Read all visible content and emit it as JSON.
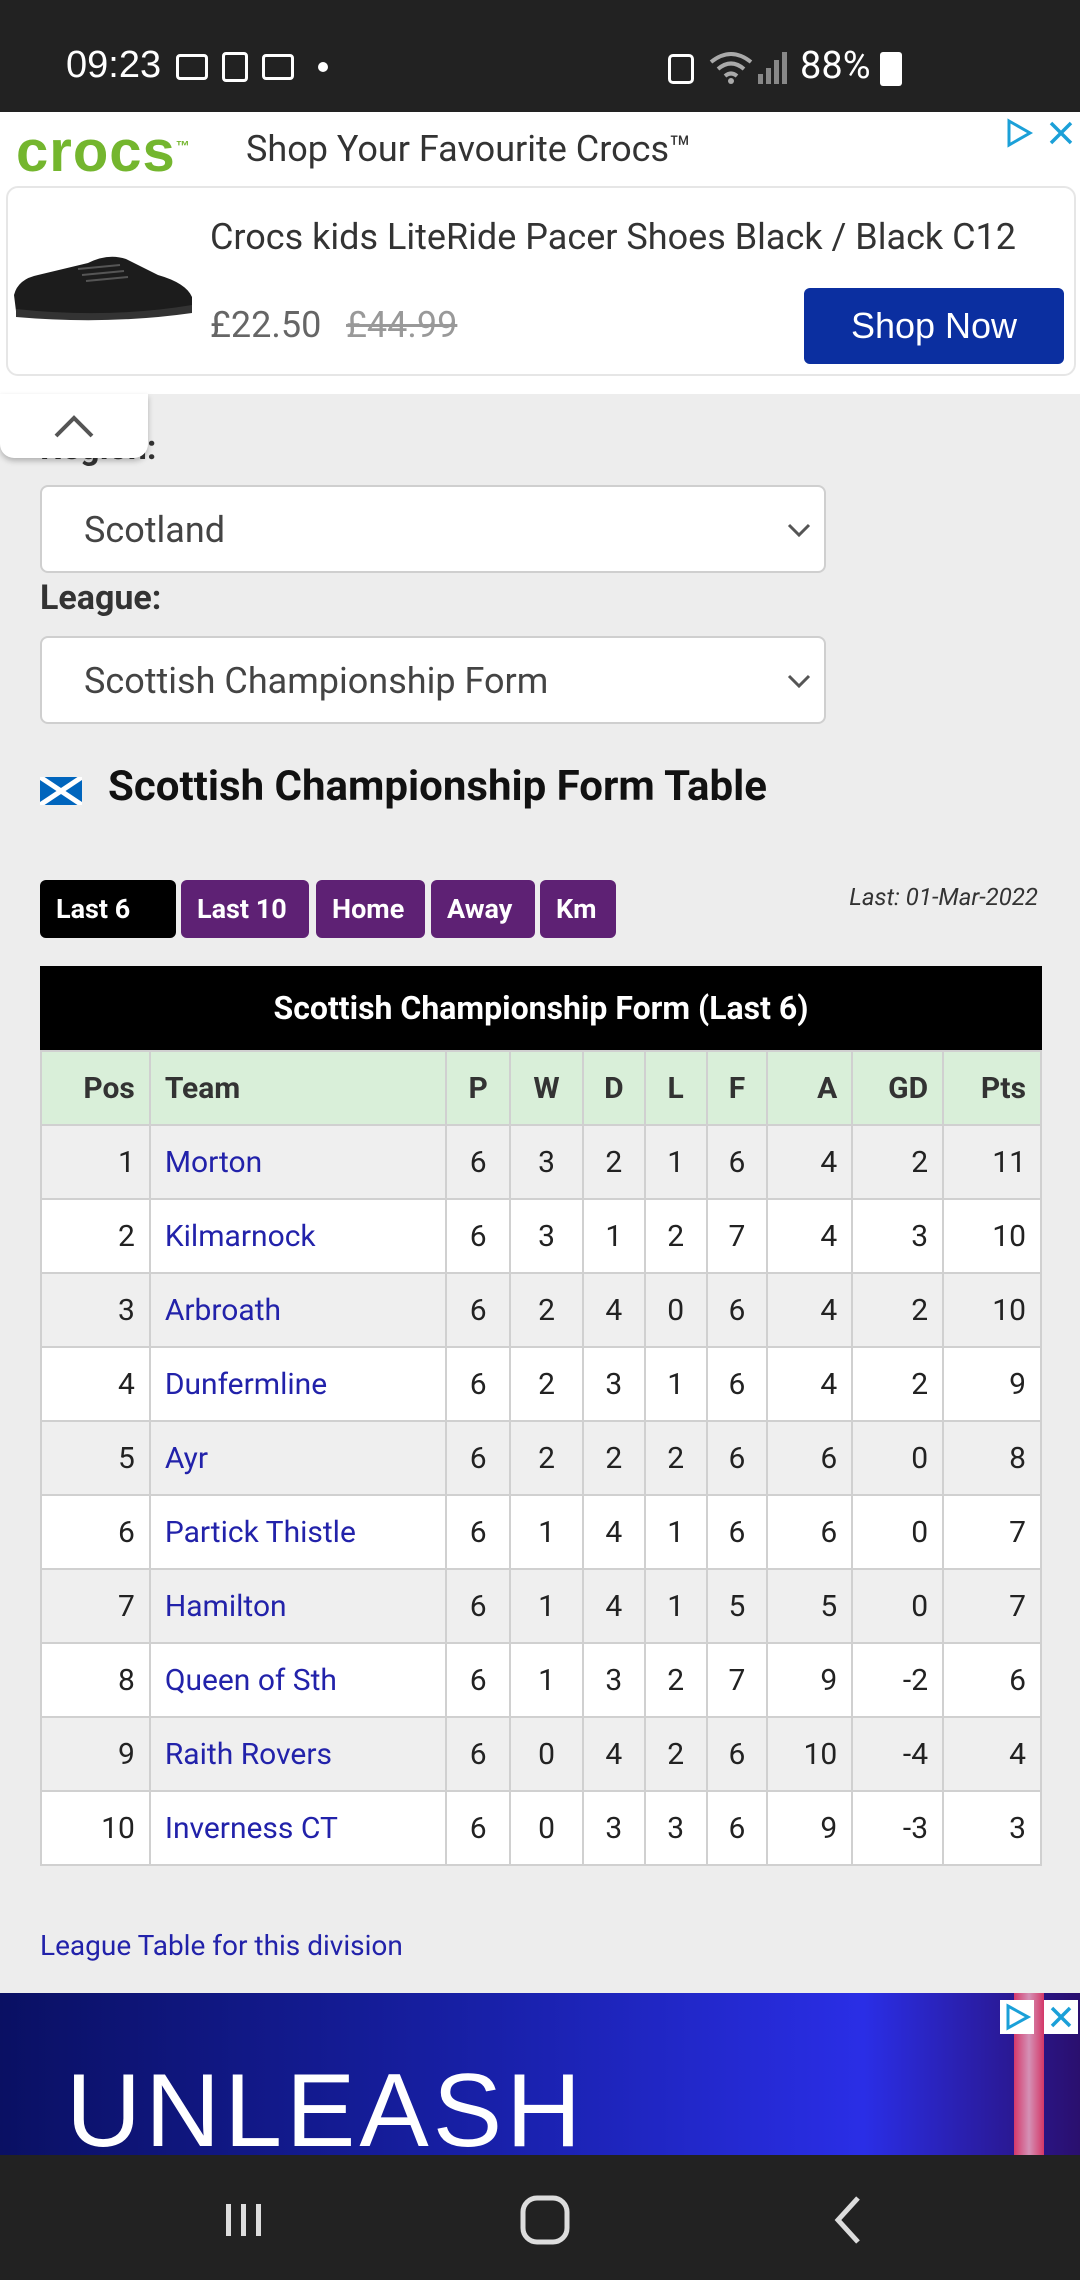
{
  "status_bar": {
    "time": "09:23",
    "battery": "88%"
  },
  "ad_top": {
    "brand": "crocs",
    "headline": "Shop Your Favourite Crocs™",
    "product": "Crocs kids LiteRide Pacer Shoes Black / Black C12",
    "price": "£22.50",
    "old_price": "£44.99",
    "cta": "Shop Now"
  },
  "filters": {
    "region_label": "Region:",
    "region_value": "Scotland",
    "league_label": "League:",
    "league_value": "Scottish Championship Form"
  },
  "page_title": "Scottish Championship Form Table",
  "tabs": [
    {
      "label": "Last 6",
      "active": true
    },
    {
      "label": "Last 10",
      "active": false
    },
    {
      "label": "Home",
      "active": false
    },
    {
      "label": "Away",
      "active": false
    },
    {
      "label": "Km",
      "active": false
    }
  ],
  "last_updated": "Last: 01-Mar-2022",
  "table": {
    "title": "Scottish Championship Form (Last 6)",
    "columns": [
      "Pos",
      "Team",
      "P",
      "W",
      "D",
      "L",
      "F",
      "A",
      "GD",
      "Pts"
    ],
    "rows": [
      {
        "pos": "1",
        "team": "Morton",
        "p": "6",
        "w": "3",
        "d": "2",
        "l": "1",
        "f": "6",
        "a": "4",
        "gd": "2",
        "pts": "11"
      },
      {
        "pos": "2",
        "team": "Kilmarnock",
        "p": "6",
        "w": "3",
        "d": "1",
        "l": "2",
        "f": "7",
        "a": "4",
        "gd": "3",
        "pts": "10"
      },
      {
        "pos": "3",
        "team": "Arbroath",
        "p": "6",
        "w": "2",
        "d": "4",
        "l": "0",
        "f": "6",
        "a": "4",
        "gd": "2",
        "pts": "10"
      },
      {
        "pos": "4",
        "team": "Dunfermline",
        "p": "6",
        "w": "2",
        "d": "3",
        "l": "1",
        "f": "6",
        "a": "4",
        "gd": "2",
        "pts": "9"
      },
      {
        "pos": "5",
        "team": "Ayr",
        "p": "6",
        "w": "2",
        "d": "2",
        "l": "2",
        "f": "6",
        "a": "6",
        "gd": "0",
        "pts": "8"
      },
      {
        "pos": "6",
        "team": "Partick Thistle",
        "p": "6",
        "w": "1",
        "d": "4",
        "l": "1",
        "f": "6",
        "a": "6",
        "gd": "0",
        "pts": "7"
      },
      {
        "pos": "7",
        "team": "Hamilton",
        "p": "6",
        "w": "1",
        "d": "4",
        "l": "1",
        "f": "5",
        "a": "5",
        "gd": "0",
        "pts": "7"
      },
      {
        "pos": "8",
        "team": "Queen of Sth",
        "p": "6",
        "w": "1",
        "d": "3",
        "l": "2",
        "f": "7",
        "a": "9",
        "gd": "-2",
        "pts": "6"
      },
      {
        "pos": "9",
        "team": "Raith Rovers",
        "p": "6",
        "w": "0",
        "d": "4",
        "l": "2",
        "f": "6",
        "a": "10",
        "gd": "-4",
        "pts": "4"
      },
      {
        "pos": "10",
        "team": "Inverness CT",
        "p": "6",
        "w": "0",
        "d": "3",
        "l": "3",
        "f": "6",
        "a": "9",
        "gd": "-3",
        "pts": "3"
      }
    ]
  },
  "league_link": "League Table for this division",
  "ad_bottom": {
    "text": "UNLEASH"
  },
  "colors": {
    "tab_active": "#000000",
    "tab_purple": "#5e2174",
    "header_green": "#d9efd9",
    "link_blue": "#2222aa",
    "shop_now": "#0b2fa0",
    "crocs_green": "#74b62e"
  }
}
